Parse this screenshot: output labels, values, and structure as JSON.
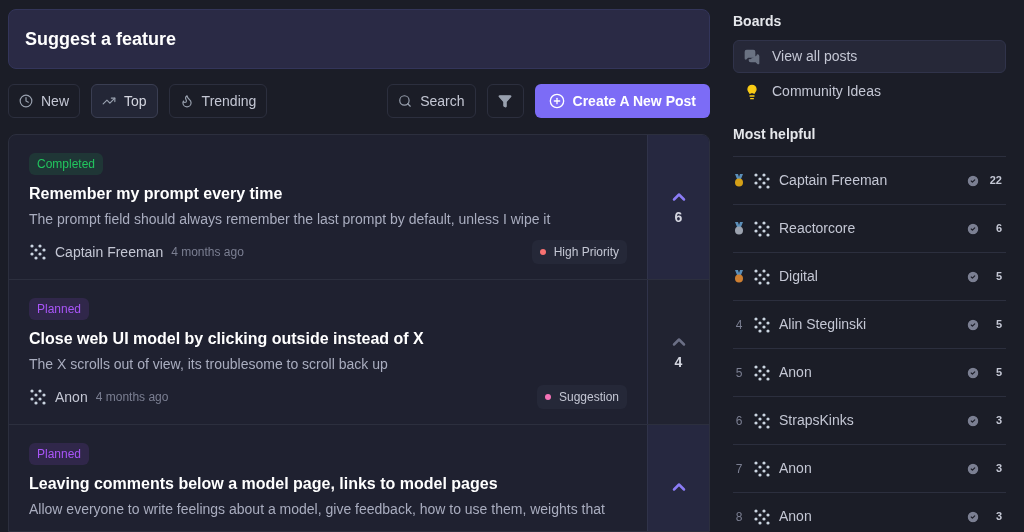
{
  "header": {
    "title": "Suggest a feature"
  },
  "sort_tabs": [
    {
      "label": "New",
      "kind": "clock",
      "selected": false
    },
    {
      "label": "Top",
      "kind": "trend",
      "selected": true
    },
    {
      "label": "Trending",
      "kind": "flame",
      "selected": false
    }
  ],
  "toolbar": {
    "search_label": "Search",
    "create_label": "Create A New Post"
  },
  "posts": [
    {
      "status": {
        "label": "Completed",
        "color": "#22c55e"
      },
      "title": "Remember my prompt every time",
      "description": "The prompt field should always remember the last prompt by default, unless I wipe it",
      "author": "Captain Freeman",
      "time": "4 months ago",
      "tag": {
        "label": "High Priority",
        "color": "#f87171"
      },
      "voted": true,
      "votes": "6"
    },
    {
      "status": {
        "label": "Planned",
        "color": "#a855f7"
      },
      "title": "Close web UI model by clicking outside instead of X",
      "description": "The X scrolls out of view, its troublesome to scroll back up",
      "author": "Anon",
      "time": "4 months ago",
      "tag": {
        "label": "Suggestion",
        "color": "#f472b6"
      },
      "voted": false,
      "votes": "4"
    },
    {
      "status": {
        "label": "Planned",
        "color": "#a855f7"
      },
      "title": "Leaving comments below a model page, links to model pages",
      "description": "Allow everyone to write feelings about a model, give feedback, how to use them, weights that",
      "voted": true
    }
  ],
  "boards": {
    "title": "Boards",
    "items": [
      {
        "label": "View all posts",
        "kind": "chat",
        "selected": true
      },
      {
        "label": "Community Ideas",
        "kind": "bulb",
        "selected": false
      }
    ]
  },
  "most_helpful": {
    "title": "Most helpful",
    "users": [
      {
        "kind": "medal",
        "color": "#d4a017",
        "name": "Captain Freeman",
        "count": "22"
      },
      {
        "kind": "medal",
        "color": "#9ca3af",
        "name": "Reactorcore",
        "count": "6"
      },
      {
        "kind": "medal",
        "color": "#cd7f32",
        "name": "Digital",
        "count": "5"
      },
      {
        "kind": "rank",
        "rank": "4",
        "name": "Alin Steglinski",
        "count": "5"
      },
      {
        "kind": "rank",
        "rank": "5",
        "name": "Anon",
        "count": "5"
      },
      {
        "kind": "rank",
        "rank": "6",
        "name": "StrapsKinks",
        "count": "3"
      },
      {
        "kind": "rank",
        "rank": "7",
        "name": "Anon",
        "count": "3"
      },
      {
        "kind": "rank",
        "rank": "8",
        "name": "Anon",
        "count": "3"
      }
    ]
  }
}
